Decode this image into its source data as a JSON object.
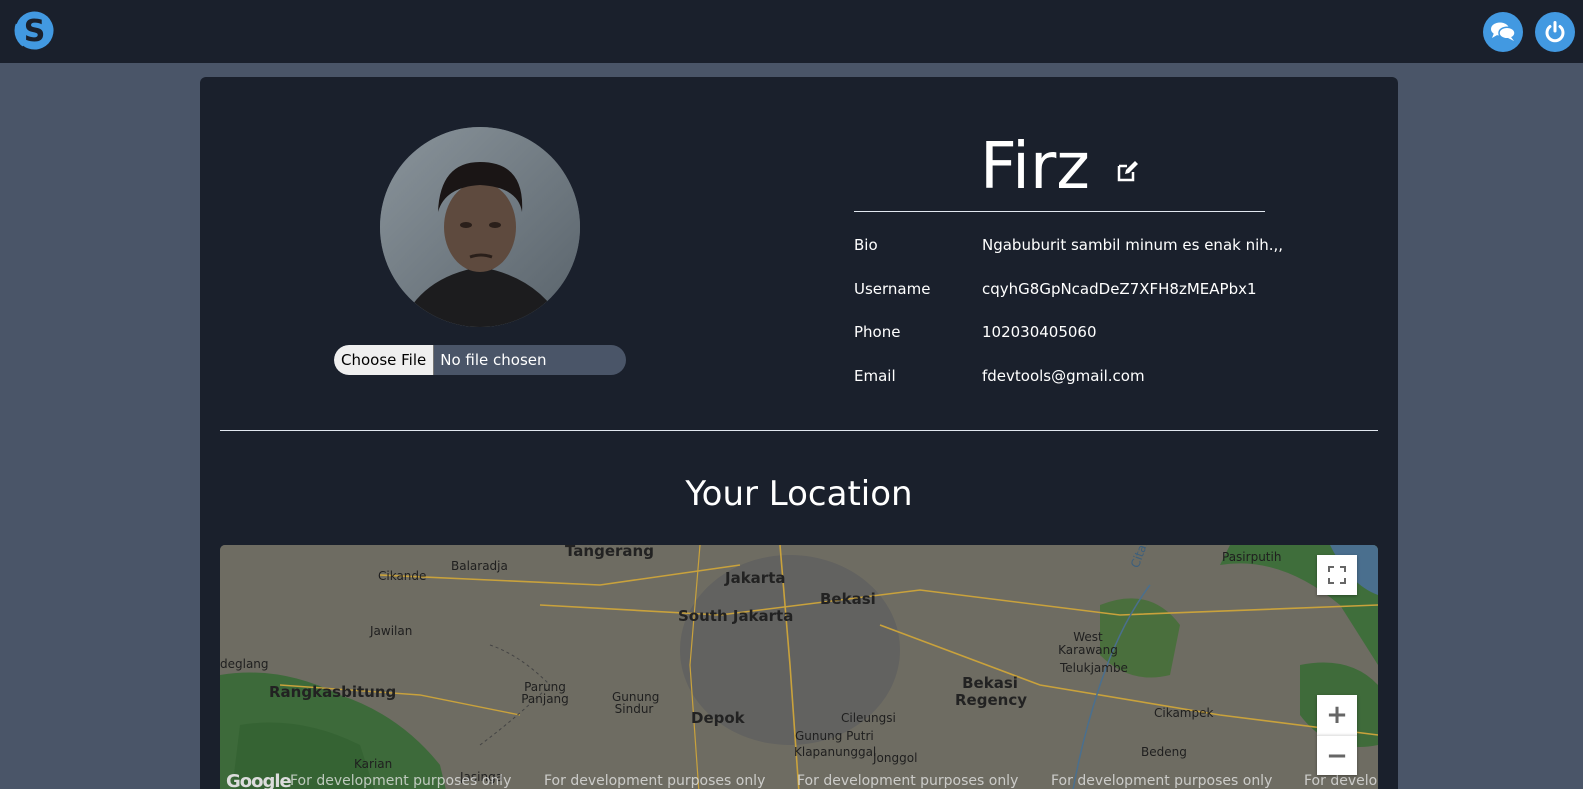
{
  "navbar": {
    "logo_letter": "S",
    "colors": {
      "bg": "#1a202c",
      "accent": "#4299e1"
    },
    "buttons": [
      {
        "icon": "chat-icon"
      },
      {
        "icon": "power-icon"
      }
    ]
  },
  "profile": {
    "name": "Firz",
    "file_input": {
      "button_label": "Choose File",
      "status": "No file chosen"
    },
    "fields": [
      {
        "label": "Bio",
        "value": "Ngabuburit sambil minum es enak nih.,,"
      },
      {
        "label": "Username",
        "value": "cqyhG8GpNcadDeZ7XFH8zMEAPbx1"
      },
      {
        "label": "Phone",
        "value": "102030405060"
      },
      {
        "label": "Email",
        "value": "fdevtools@gmail.com"
      }
    ]
  },
  "location": {
    "title": "Your Location",
    "map": {
      "places": [
        "Tangerang",
        "Jakarta",
        "South Jakarta",
        "Bekasi",
        "Cikande",
        "Balaradja",
        "Jawilan",
        "Rangkasbitung",
        "Parung Panjang",
        "Gunung Sindur",
        "Depok",
        "Cileungsi",
        "Gunung Putri",
        "Klapanunggal",
        "Jonggol",
        "Bekasi Regency",
        "West Karawang",
        "Telukjambe",
        "Cikampek",
        "Bedeng",
        "Pasirputih",
        "Citarum River",
        "Karian",
        "Jasinga",
        "deglang"
      ],
      "watermark": "For development purposes only",
      "attribution": "Google",
      "zoom_in": "+",
      "zoom_out": "−"
    }
  }
}
